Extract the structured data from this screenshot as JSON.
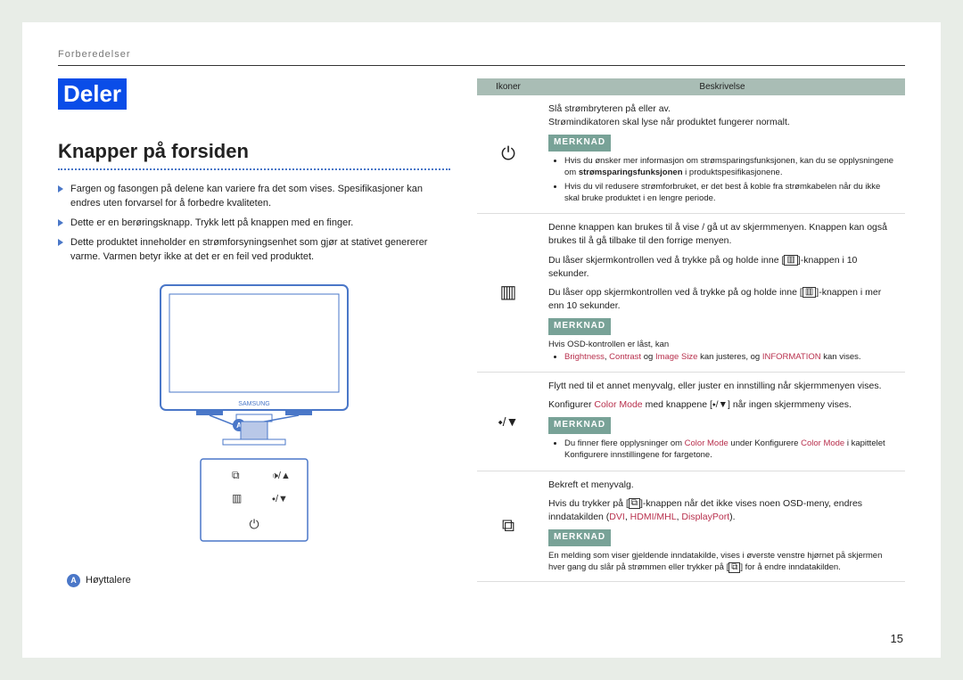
{
  "header": "Forberedelser",
  "section_badge": "Deler",
  "subsection_title": "Knapper på forsiden",
  "left_bullets": [
    "Fargen og fasongen på delene kan variere fra det som vises. Spesifikasjoner kan endres uten forvarsel for å forbedre kvaliteten.",
    "Dette er en berøringsknapp. Trykk lett på knappen med en finger.",
    "Dette produktet inneholder en strømforsyningsenhet som gjør at stativet genererer varme. Varmen betyr ikke at det er en feil ved produktet."
  ],
  "legend_letter": "A",
  "legend_text": "Høyttalere",
  "table_headers": {
    "icons": "Ikoner",
    "desc": "Beskrivelse"
  },
  "row_power": {
    "p1": "Slå strømbryteren på eller av.",
    "p2": "Strømindikatoren skal lyse når produktet fungerer normalt.",
    "note_label": "MERKNAD",
    "n1a": "Hvis du ønsker mer informasjon om strømsparingsfunksjonen, kan du se opplysningene om ",
    "n1b": "strømsparingsfunksjonen",
    "n1c": " i produktspesifikasjonene.",
    "n2": "Hvis du vil redusere strømforbruket, er det best å koble fra strømkabelen når du ikke skal bruke produktet i en lengre periode."
  },
  "row_menu": {
    "p1": "Denne knappen kan brukes til å vise / gå ut av skjermmenyen. Knappen kan også brukes til å gå tilbake til den forrige menyen.",
    "p2a": "Du låser skjermkontrollen ved å trykke på og holde inne [",
    "p2b": "]-knappen i 10 sekunder.",
    "p3a": "Du låser opp skjermkontrollen ved å trykke på og holde inne [",
    "p3b": "]-knappen i mer enn 10 sekunder.",
    "note_label": "MERKNAD",
    "small1": "Hvis OSD-kontrollen er låst, kan",
    "b1": "Brightness",
    "sep": ", ",
    "b2": "Contrast",
    "mid": " og ",
    "b3": "Image Size",
    "mid2": " kan justeres, og ",
    "b4": "INFORMATION",
    "end": " kan vises."
  },
  "row_nav": {
    "p1": "Flytt ned til et annet menyvalg, eller juster en innstilling når skjermmenyen vises.",
    "p2a": "Konfigurer ",
    "p2b": "Color Mode",
    "p2c": " med knappene [",
    "p2d": "] når ingen skjermmeny vises.",
    "note_label": "MERKNAD",
    "n1a": "Du finner flere opplysninger om ",
    "n1b": "Color Mode",
    "n1c": " under Konfigurere ",
    "n1d": "Color Mode",
    "n1e": " i kapittelet Konfigurere innstillingene for fargetone."
  },
  "row_source": {
    "p1": "Bekreft et menyvalg.",
    "p2a": "Hvis du trykker på [",
    "p2b": "]-knappen når det ikke vises noen OSD-meny, endres inndatakilden (",
    "p2c": "DVI",
    "p2d": "HDMI/MHL",
    "p2e": "DisplayPort",
    "p2f": ").",
    "note_label": "MERKNAD",
    "s1a": "En melding som viser gjeldende inndatakilde, vises i øverste venstre hjørnet på skjermen hver gang du slår på strømmen eller trykker på [",
    "s1b": "] for å endre inndatakilden."
  },
  "page_number": "15",
  "button_glyphs": {
    "volume": "🔁  🔊/▲",
    "menu_nav": "▥  ⬩/▼",
    "power": "⏻"
  }
}
